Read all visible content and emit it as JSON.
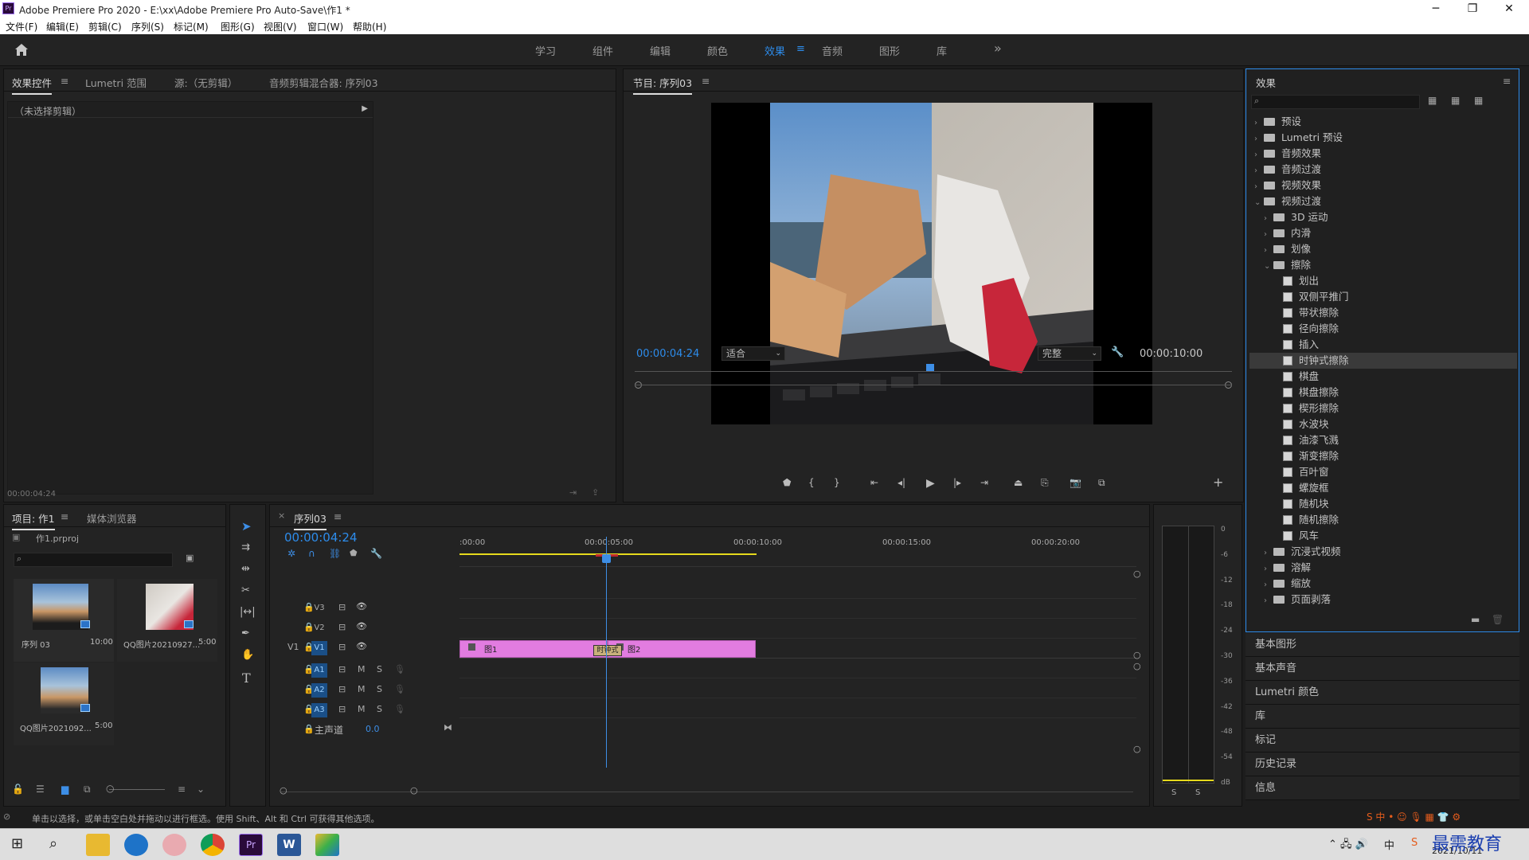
{
  "window": {
    "title": "Adobe Premiere Pro 2020 - E:\\xx\\Adobe Premiere Pro Auto-Save\\作1 *",
    "logo": "Pr",
    "minimize": "─",
    "maximize": "❐",
    "close": "✕"
  },
  "menu": [
    "文件(F)",
    "编辑(E)",
    "剪辑(C)",
    "序列(S)",
    "标记(M)",
    "图形(G)",
    "视图(V)",
    "窗口(W)",
    "帮助(H)"
  ],
  "workspaces": [
    "学习",
    "组件",
    "编辑",
    "颜色",
    "效果",
    "音频",
    "图形",
    "库"
  ],
  "active_workspace": "效果",
  "more_glyph": "»",
  "source_panel": {
    "tabs": [
      "效果控件",
      "Lumetri 范围",
      "源:（无剪辑）",
      "音频剪辑混合器: 序列03"
    ],
    "no_clip": "（未选择剪辑）",
    "timecode": "00:00:04:24"
  },
  "program": {
    "title": "节目: 序列03",
    "timecode": "00:00:04:24",
    "fit": "适合",
    "quality": "完整",
    "duration": "00:00:10:00",
    "playhead": 0.495
  },
  "project": {
    "tabs": [
      "项目: 作1",
      "媒体浏览器"
    ],
    "file": "作1.prproj",
    "items": [
      {
        "name": "序列 03",
        "duration": "10:00"
      },
      {
        "name": "QQ图片20210927...",
        "duration": "5:00"
      },
      {
        "name": "QQ图片2021092...",
        "duration": "5:00"
      }
    ]
  },
  "timeline": {
    "title": "序列03",
    "timecode": "00:00:04:24",
    "ruler": [
      ":00:00",
      "00:00:05:00",
      "00:00:10:00",
      "00:00:15:00",
      "00:00:20:00"
    ],
    "video_tracks": [
      {
        "name": "V3"
      },
      {
        "name": "V2"
      },
      {
        "name": "V1",
        "source": "V1"
      }
    ],
    "audio_tracks": [
      {
        "name": "A1"
      },
      {
        "name": "A2"
      },
      {
        "name": "A3"
      }
    ],
    "master": {
      "label": "主声道",
      "value": "0.0"
    },
    "clips": [
      {
        "name": "图1"
      },
      {
        "name": "图2"
      }
    ],
    "transition": "时钟式",
    "m_label": "M",
    "s_label": "S"
  },
  "meter": {
    "scale": [
      "0",
      "-6",
      "-12",
      "-18",
      "-24",
      "-30",
      "-36",
      "-42",
      "-48",
      "-54",
      "dB"
    ],
    "s_labels": [
      "S",
      "S"
    ]
  },
  "effects": {
    "title": "效果",
    "tree": [
      {
        "label": "预设",
        "level": 0,
        "kind": "folder",
        "exp": "closed"
      },
      {
        "label": "Lumetri 预设",
        "level": 0,
        "kind": "folder",
        "exp": "closed"
      },
      {
        "label": "音频效果",
        "level": 0,
        "kind": "folder",
        "exp": "closed"
      },
      {
        "label": "音频过渡",
        "level": 0,
        "kind": "folder",
        "exp": "closed"
      },
      {
        "label": "视频效果",
        "level": 0,
        "kind": "folder",
        "exp": "closed"
      },
      {
        "label": "视频过渡",
        "level": 0,
        "kind": "folder",
        "exp": "open"
      },
      {
        "label": "3D 运动",
        "level": 1,
        "kind": "folder",
        "exp": "closed"
      },
      {
        "label": "内滑",
        "level": 1,
        "kind": "folder",
        "exp": "closed"
      },
      {
        "label": "划像",
        "level": 1,
        "kind": "folder",
        "exp": "closed"
      },
      {
        "label": "擦除",
        "level": 1,
        "kind": "folder",
        "exp": "open"
      },
      {
        "label": "划出",
        "level": 2,
        "kind": "fx"
      },
      {
        "label": "双侧平推门",
        "level": 2,
        "kind": "fx"
      },
      {
        "label": "带状擦除",
        "level": 2,
        "kind": "fx"
      },
      {
        "label": "径向擦除",
        "level": 2,
        "kind": "fx"
      },
      {
        "label": "插入",
        "level": 2,
        "kind": "fx"
      },
      {
        "label": "时钟式擦除",
        "level": 2,
        "kind": "fx",
        "selected": true
      },
      {
        "label": "棋盘",
        "level": 2,
        "kind": "fx"
      },
      {
        "label": "棋盘擦除",
        "level": 2,
        "kind": "fx"
      },
      {
        "label": "楔形擦除",
        "level": 2,
        "kind": "fx"
      },
      {
        "label": "水波块",
        "level": 2,
        "kind": "fx"
      },
      {
        "label": "油漆飞溅",
        "level": 2,
        "kind": "fx"
      },
      {
        "label": "渐变擦除",
        "level": 2,
        "kind": "fx"
      },
      {
        "label": "百叶窗",
        "level": 2,
        "kind": "fx"
      },
      {
        "label": "螺旋框",
        "level": 2,
        "kind": "fx"
      },
      {
        "label": "随机块",
        "level": 2,
        "kind": "fx"
      },
      {
        "label": "随机擦除",
        "level": 2,
        "kind": "fx"
      },
      {
        "label": "风车",
        "level": 2,
        "kind": "fx"
      },
      {
        "label": "沉浸式视频",
        "level": 1,
        "kind": "folder",
        "exp": "closed"
      },
      {
        "label": "溶解",
        "level": 1,
        "kind": "folder",
        "exp": "closed"
      },
      {
        "label": "缩放",
        "level": 1,
        "kind": "folder",
        "exp": "closed"
      },
      {
        "label": "页面剥落",
        "level": 1,
        "kind": "folder",
        "exp": "closed"
      }
    ],
    "panels": [
      "基本图形",
      "基本声音",
      "Lumetri 颜色",
      "库",
      "标记",
      "历史记录",
      "信息"
    ]
  },
  "status": "单击以选择，或单击空白处并拖动以进行框选。使用 Shift、Alt 和 Ctrl 可获得其他选项。",
  "taskbar": {
    "date": "2021/10/11",
    "tray": "中",
    "watermark": "最需教育"
  },
  "colors": {
    "accent": "#2d8ceb",
    "clip": "#e27ce0",
    "playhead": "#3d8ee6",
    "selected_row": "#3a3a3a"
  }
}
